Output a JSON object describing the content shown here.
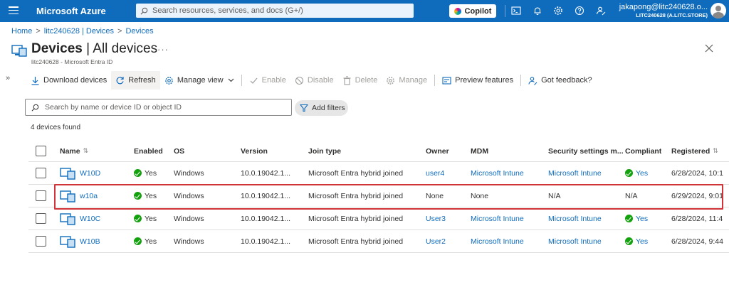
{
  "topbar": {
    "brand": "Microsoft Azure",
    "search_placeholder": "Search resources, services, and docs (G+/)",
    "copilot_label": "Copilot",
    "user_name": "jakapong@litc240628.o...",
    "user_tenant": "LITC240628 (A.LITC.STORE)",
    "icons": [
      "hamburger-icon",
      "search-icon",
      "cloud-shell-icon",
      "bell-icon",
      "gear-icon",
      "help-icon",
      "feedback-icon"
    ]
  },
  "breadcrumb": [
    "Home",
    "litc240628 | Devices",
    "Devices"
  ],
  "header": {
    "title_bold": "Devices",
    "title_rest": " | All devices",
    "more": "···",
    "subtitle": "litc240628 - Microsoft Entra ID"
  },
  "toolbar": {
    "download": "Download devices",
    "refresh": "Refresh",
    "manage_view": "Manage view",
    "enable": "Enable",
    "disable": "Disable",
    "delete": "Delete",
    "manage": "Manage",
    "preview": "Preview features",
    "feedback": "Got feedback?"
  },
  "filter": {
    "placeholder": "Search by name or device ID or object ID",
    "add_filters": "Add filters"
  },
  "count_text": "4 devices found",
  "table": {
    "columns": [
      "Name",
      "Enabled",
      "OS",
      "Version",
      "Join type",
      "Owner",
      "MDM",
      "Security settings m...",
      "Compliant",
      "Registered"
    ],
    "rows": [
      {
        "name": "W10D",
        "enabled": "Yes",
        "os": "Windows",
        "version": "10.0.19042.1...",
        "join": "Microsoft Entra hybrid joined",
        "owner": "user4",
        "mdm": "Microsoft Intune",
        "security": "Microsoft Intune",
        "compliant": "Yes",
        "registered": "6/28/2024, 10:1"
      },
      {
        "name": "w10a",
        "enabled": "Yes",
        "os": "Windows",
        "version": "10.0.19042.1...",
        "join": "Microsoft Entra hybrid joined",
        "owner": "None",
        "mdm": "None",
        "security": "N/A",
        "compliant": "N/A",
        "registered": "6/29/2024, 9:01"
      },
      {
        "name": "W10C",
        "enabled": "Yes",
        "os": "Windows",
        "version": "10.0.19042.1...",
        "join": "Microsoft Entra hybrid joined",
        "owner": "User3",
        "mdm": "Microsoft Intune",
        "security": "Microsoft Intune",
        "compliant": "Yes",
        "registered": "6/28/2024, 11:4"
      },
      {
        "name": "W10B",
        "enabled": "Yes",
        "os": "Windows",
        "version": "10.0.19042.1...",
        "join": "Microsoft Entra hybrid joined",
        "owner": "User2",
        "mdm": "Microsoft Intune",
        "security": "Microsoft Intune",
        "compliant": "Yes",
        "registered": "6/28/2024, 9:44"
      }
    ]
  },
  "colors": {
    "brand": "#0f6cbd",
    "success": "#13a10e",
    "highlight": "#d13438"
  }
}
